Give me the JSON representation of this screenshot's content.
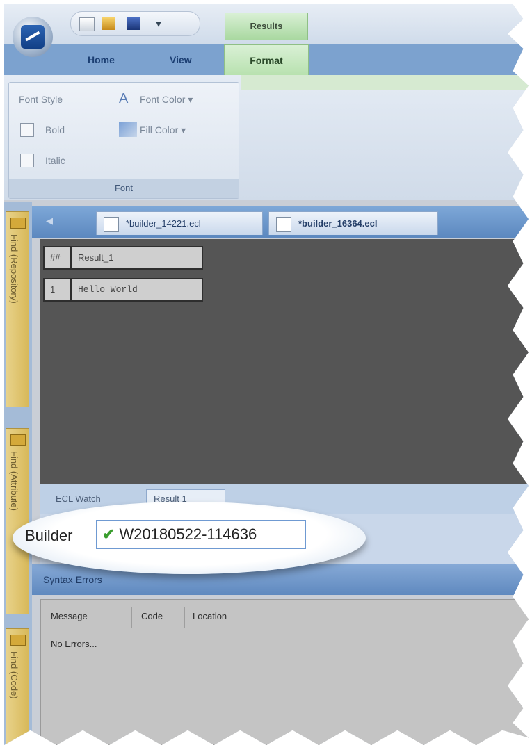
{
  "titlebar": {
    "contextual_tab": "Results",
    "qat_more": "▾"
  },
  "ribbon": {
    "tabs": [
      "Home",
      "View",
      "Format"
    ],
    "group": {
      "title": "Font",
      "font_style_label": "Font Style",
      "bold_label": "Bold",
      "italic_label": "Italic",
      "font_color_label": "Font Color ▾",
      "fill_color_label": "Fill Color ▾"
    }
  },
  "side_tabs": [
    "Find (Repository)",
    "Find (Attribute)",
    "Find (Code)"
  ],
  "doc_tabs": {
    "nav_arrow": "◀",
    "tab1": "*builder_14221.ecl",
    "tab2": "*builder_16364.ecl"
  },
  "grid": {
    "headers": [
      "##",
      "Result_1"
    ],
    "rows": [
      {
        "num": "1",
        "value": "Hello World"
      }
    ]
  },
  "bottom_tabs": [
    "ECL Watch",
    "Result 1"
  ],
  "callout": {
    "label": "Builder",
    "check": "✔",
    "workunit_id": "W20180522-114636"
  },
  "syntax_errors": {
    "title": "Syntax Errors",
    "columns": [
      "Message",
      "Code",
      "Location"
    ],
    "message": "No Errors..."
  }
}
